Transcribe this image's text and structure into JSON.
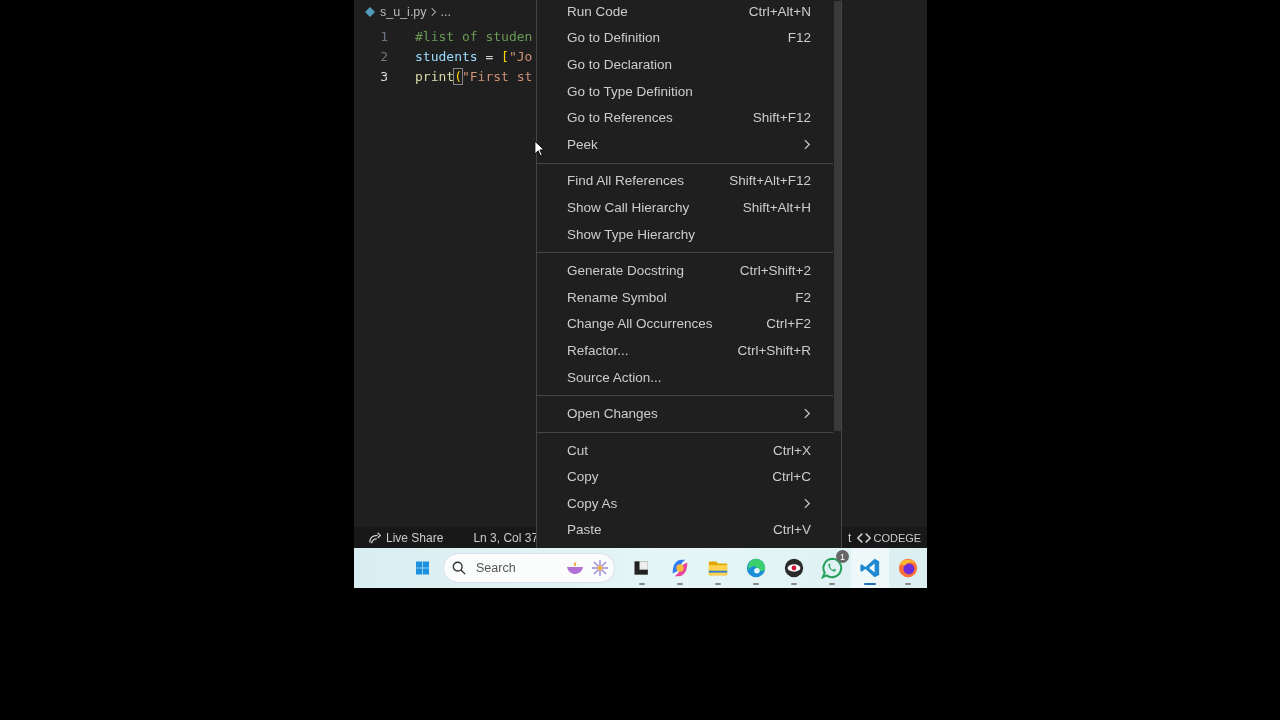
{
  "editor": {
    "breadcrumb": {
      "file": "s_u_i.py",
      "trail": "..."
    },
    "lines": [
      {
        "number": "1",
        "current": false,
        "tokens": [
          {
            "text": "#list of studen",
            "kind": "comment"
          }
        ]
      },
      {
        "number": "2",
        "current": false,
        "tokens": [
          {
            "text": "students",
            "kind": "variable"
          },
          {
            "text": " = ",
            "kind": "plain"
          },
          {
            "text": "[",
            "kind": "bracket"
          },
          {
            "text": "\"Jo",
            "kind": "string"
          }
        ]
      },
      {
        "number": "3",
        "current": true,
        "tokens": [
          {
            "text": "print",
            "kind": "function"
          },
          {
            "text": "(",
            "kind": "bracket-match"
          },
          {
            "text": "\"First st",
            "kind": "string"
          }
        ]
      }
    ]
  },
  "context_menu": {
    "groups": [
      [
        {
          "label": "Run Code",
          "shortcut": "Ctrl+Alt+N",
          "submenu": false
        },
        {
          "label": "Go to Definition",
          "shortcut": "F12",
          "submenu": false
        },
        {
          "label": "Go to Declaration",
          "submenu": false
        },
        {
          "label": "Go to Type Definition",
          "submenu": false
        },
        {
          "label": "Go to References",
          "shortcut": "Shift+F12",
          "submenu": false
        },
        {
          "label": "Peek",
          "submenu": true
        }
      ],
      [
        {
          "label": "Find All References",
          "shortcut": "Shift+Alt+F12",
          "submenu": false
        },
        {
          "label": "Show Call Hierarchy",
          "shortcut": "Shift+Alt+H",
          "submenu": false
        },
        {
          "label": "Show Type Hierarchy",
          "submenu": false
        }
      ],
      [
        {
          "label": "Generate Docstring",
          "shortcut": "Ctrl+Shift+2",
          "submenu": false
        },
        {
          "label": "Rename Symbol",
          "shortcut": "F2",
          "submenu": false
        },
        {
          "label": "Change All Occurrences",
          "shortcut": "Ctrl+F2",
          "submenu": false
        },
        {
          "label": "Refactor...",
          "shortcut": "Ctrl+Shift+R",
          "submenu": false
        },
        {
          "label": "Source Action...",
          "submenu": false
        }
      ],
      [
        {
          "label": "Open Changes",
          "submenu": true
        }
      ],
      [
        {
          "label": "Cut",
          "shortcut": "Ctrl+X",
          "submenu": false
        },
        {
          "label": "Copy",
          "shortcut": "Ctrl+C",
          "submenu": false
        },
        {
          "label": "Copy As",
          "submenu": true
        },
        {
          "label": "Paste",
          "shortcut": "Ctrl+V",
          "submenu": false
        }
      ]
    ]
  },
  "status_bar": [
    {
      "kind": "live-share",
      "label": "Live Share"
    },
    {
      "kind": "position",
      "label": "Ln 3, Col 37"
    },
    {
      "kind": "partial",
      "label": "t"
    },
    {
      "kind": "codegeex",
      "label": "CODEGE"
    }
  ],
  "taskbar": {
    "search": {
      "placeholder": "Search"
    },
    "apps": [
      {
        "kind": "terminal",
        "selected": false
      },
      {
        "kind": "copilot",
        "selected": false
      },
      {
        "kind": "folder",
        "selected": false
      },
      {
        "kind": "edge",
        "selected": false
      },
      {
        "kind": "eye",
        "selected": false
      },
      {
        "kind": "whatsapp",
        "selected": false,
        "badge": "1"
      },
      {
        "kind": "vscode",
        "selected": true
      },
      {
        "kind": "firefox",
        "selected": false
      }
    ]
  }
}
